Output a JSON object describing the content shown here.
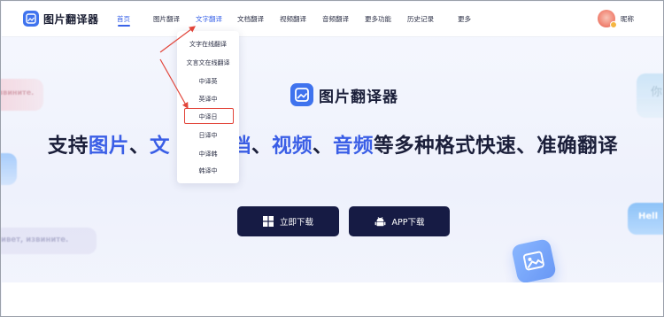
{
  "app": {
    "logo_text": "图片翻译器",
    "logo_icon": "image-translate-icon",
    "brand_color": "#3f73ee"
  },
  "nav": {
    "items": [
      {
        "label": "首页",
        "active": true
      },
      {
        "label": "图片翻译"
      },
      {
        "label": "文字翻译",
        "highlighted": true
      },
      {
        "label": "文档翻译"
      },
      {
        "label": "视频翻译"
      },
      {
        "label": "音频翻译"
      },
      {
        "label": "更多功能"
      },
      {
        "label": "历史记录"
      },
      {
        "label": "更多"
      }
    ],
    "active_color": "#3a63e8"
  },
  "user": {
    "nickname": "昵称",
    "avatar_icon": "user-avatar-icon"
  },
  "dropdown": {
    "items": [
      {
        "label": "文字在线翻译"
      },
      {
        "label": "文言文在线翻译"
      },
      {
        "label": "中译英"
      },
      {
        "label": "英译中"
      },
      {
        "label": "中译日",
        "annotated": true
      },
      {
        "label": "日译中"
      },
      {
        "label": "中译韩"
      },
      {
        "label": "韩译中"
      }
    ],
    "annotation_color": "#e2453a"
  },
  "hero": {
    "logo_text": "图片翻译器",
    "slogan_parts": [
      {
        "text": "支持"
      },
      {
        "text": "图片",
        "highlight": true
      },
      {
        "text": "、"
      },
      {
        "text": "文",
        "highlight": true
      },
      {
        "text": "　　"
      },
      {
        "text": "文档",
        "highlight": true
      },
      {
        "text": "、"
      },
      {
        "text": "视频",
        "highlight": true
      },
      {
        "text": "、"
      },
      {
        "text": "音频",
        "highlight": true
      },
      {
        "text": "等多种格式快速、准确翻译"
      }
    ],
    "highlight_color": "#3a5ee6",
    "download_button": {
      "label": "立即下载",
      "icon": "windows-icon"
    },
    "app_button": {
      "label": "APP下载",
      "icon": "android-icon"
    },
    "button_color": "#161b44"
  },
  "decorations": {
    "bubble_left_top": "извините.",
    "bubble_left_bottom": "ивет, извините.",
    "bubble_right_top": "你",
    "bubble_right_bottom": "Hell"
  }
}
